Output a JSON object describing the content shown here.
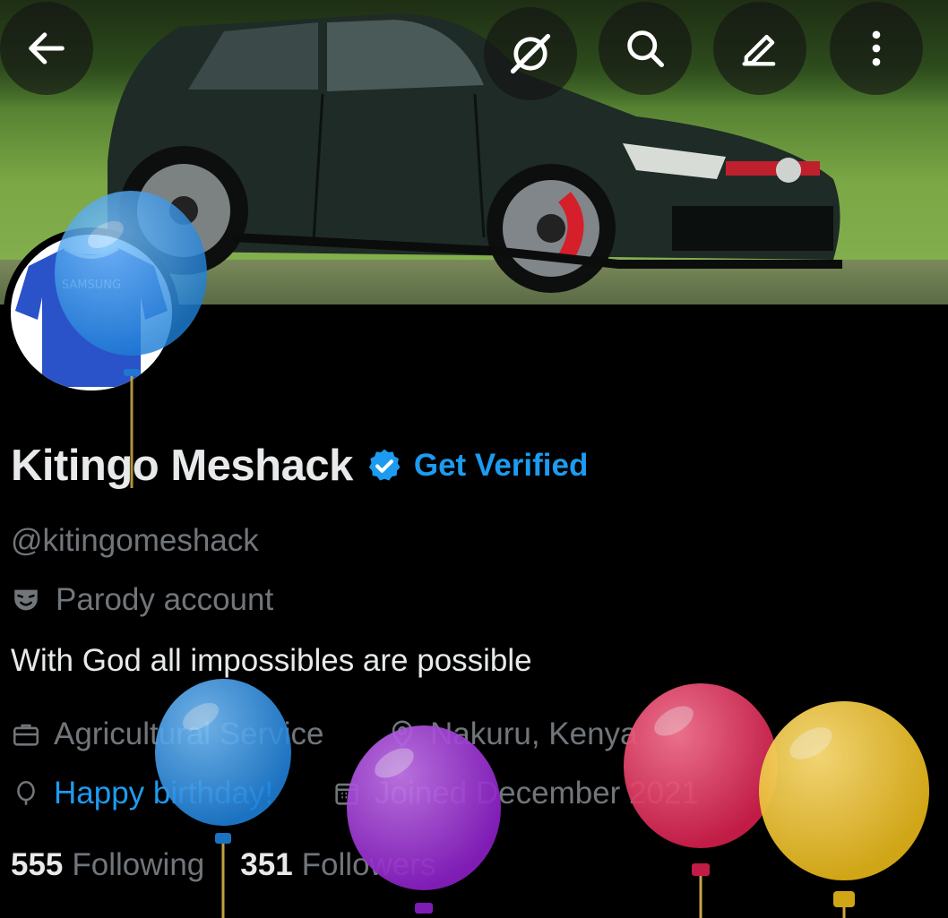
{
  "profile": {
    "name": "Kitingo Meshack",
    "verify_label": "Get Verified",
    "handle": "@kitingomeshack",
    "parody_label": "Parody account",
    "bio": "With God all impossibles are possible",
    "profession": "Agricultural Service",
    "location": "Nakuru, Kenya",
    "birthday": "Happy birthday!",
    "joined": "Joined December 2021",
    "following_count": "555",
    "following_label": "Following",
    "followers_count": "351",
    "followers_label": "Followers"
  },
  "avatar": {
    "shirt_text": "SAMSUNG"
  },
  "icons": {
    "back": "back-arrow-icon",
    "grok": "grok-icon",
    "search": "search-icon",
    "edit": "edit-icon",
    "more": "more-vertical-icon"
  },
  "colors": {
    "accent": "#1d9bf0",
    "muted": "#71767b",
    "text": "#e7e9ea",
    "background": "#000000",
    "balloon_blue": "#2b8fe3",
    "balloon_purple": "#9a2fd0",
    "balloon_red": "#e0345e",
    "balloon_yellow": "#e7b62c"
  }
}
